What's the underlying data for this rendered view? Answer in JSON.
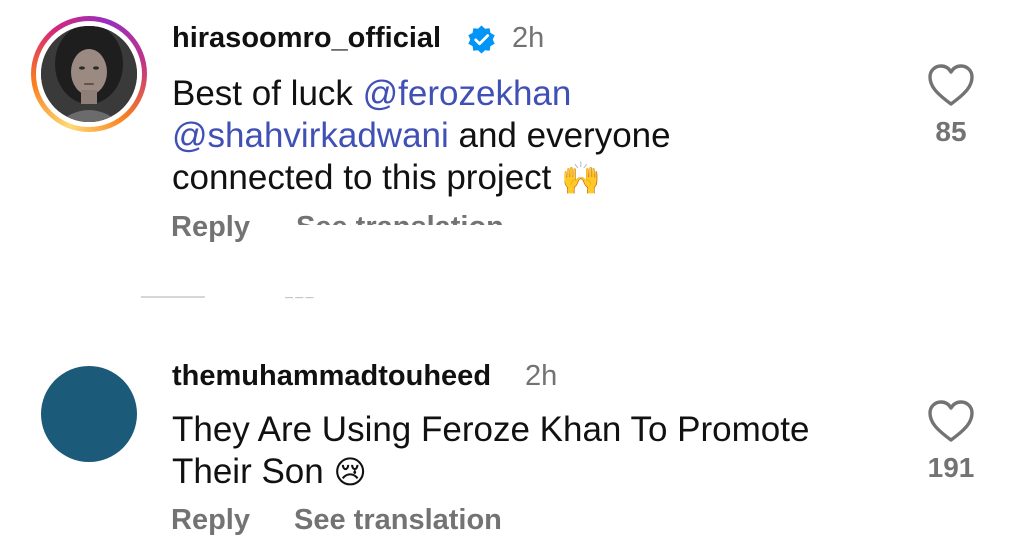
{
  "comments": [
    {
      "username": "hirasoomro_official",
      "verified": true,
      "time": "2h",
      "text_before": "Best of luck ",
      "mention1": "@ferozekhan",
      "mention2": "@shahvirkadwani",
      "text_after": " and everyone",
      "text_line3": "connected to this project ",
      "emoji": "🙌",
      "reply_label": "Reply",
      "see_translation_label": "See translation",
      "likes": "85"
    },
    {
      "username": "themuhammadtouheed",
      "verified": false,
      "time": "2h",
      "text_line1": "They Are Using Feroze Khan To Promote",
      "text_line2": "Their Son ",
      "emoji": "😢",
      "reply_label": "Reply",
      "see_translation_label": "See translation",
      "likes": "191"
    }
  ],
  "colors": {
    "mention": "#4150b5",
    "verified_badge": "#0095f6",
    "secondary_text": "#737373"
  },
  "icons": {
    "like": "heart-outline-icon",
    "verified": "verified-badge-icon"
  }
}
